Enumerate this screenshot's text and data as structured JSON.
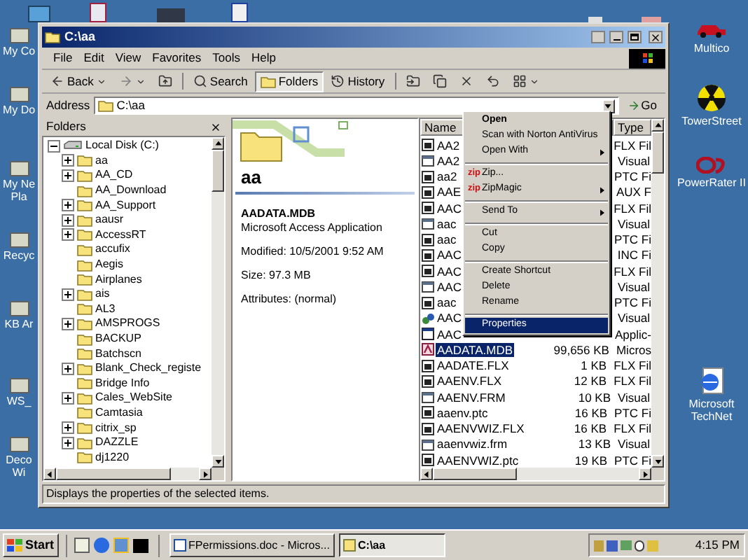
{
  "desktop": {
    "left_icons": [
      {
        "label": "My Co"
      },
      {
        "label": "My Do"
      },
      {
        "label": "My Ne\nPla"
      },
      {
        "label": "Recyc"
      },
      {
        "label": "KB Ar"
      },
      {
        "label": "WS_"
      },
      {
        "label": "Deco\nWi"
      }
    ],
    "right_icons": [
      {
        "label": "Multico",
        "kind": "car"
      },
      {
        "label": "TowerStreet",
        "kind": "radiation"
      },
      {
        "label": "PowerRater II",
        "kind": "logo"
      },
      {
        "label": "Microsoft\nTechNet",
        "kind": "globe"
      }
    ]
  },
  "window": {
    "title": "C:\\aa",
    "menu": [
      "File",
      "Edit",
      "View",
      "Favorites",
      "Tools",
      "Help"
    ],
    "toolbar": [
      {
        "label": "Back",
        "kind": "back"
      },
      {
        "kind": "forward"
      },
      {
        "kind": "up"
      },
      {
        "label": "Search",
        "kind": "search",
        "selected": false
      },
      {
        "label": "Folders",
        "kind": "folders",
        "selected": true
      },
      {
        "label": "History",
        "kind": "history",
        "selected": false
      },
      {
        "kind": "move"
      },
      {
        "kind": "copy"
      },
      {
        "kind": "delete"
      },
      {
        "kind": "undo"
      },
      {
        "kind": "views"
      }
    ],
    "address": {
      "label": "Address",
      "value": "C:\\aa",
      "go": "Go"
    },
    "folders": {
      "title": "Folders",
      "tree": [
        {
          "label": "Local Disk (C:)",
          "expanded": true,
          "children": [
            {
              "label": "aa",
              "expandable": true
            },
            {
              "label": "AA_CD",
              "expandable": true
            },
            {
              "label": "AA_Download",
              "expandable": false
            },
            {
              "label": "AA_Support",
              "expandable": true
            },
            {
              "label": "aausr",
              "expandable": true
            },
            {
              "label": "AccessRT",
              "expandable": true
            },
            {
              "label": "accufix",
              "expandable": false
            },
            {
              "label": "Aegis",
              "expandable": false
            },
            {
              "label": "Airplanes",
              "expandable": false
            },
            {
              "label": "ais",
              "expandable": true
            },
            {
              "label": "AL3",
              "expandable": false
            },
            {
              "label": "AMSPROGS",
              "expandable": true
            },
            {
              "label": "BACKUP",
              "expandable": false
            },
            {
              "label": "Batchscn",
              "expandable": false
            },
            {
              "label": "Blank_Check_registe",
              "expandable": true
            },
            {
              "label": "Bridge Info",
              "expandable": false
            },
            {
              "label": "Cales_WebSite",
              "expandable": true
            },
            {
              "label": "Camtasia",
              "expandable": false
            },
            {
              "label": "citrix_sp",
              "expandable": true
            },
            {
              "label": "DAZZLE",
              "expandable": true
            },
            {
              "label": "dj1220",
              "expandable": false
            }
          ]
        }
      ]
    },
    "preview": {
      "folder": "aa",
      "file": "AADATA.MDB",
      "type": "Microsoft Access Application",
      "modified": "Modified: 10/5/2001 9:52 AM",
      "size": "Size: 97.3 MB",
      "attributes": "Attributes: (normal)"
    },
    "files": {
      "columns": [
        "Name",
        "Type"
      ],
      "rows": [
        {
          "name": "AA2",
          "type": "FLX Fil",
          "kind": "document",
          "selected": false
        },
        {
          "name": "AA2",
          "type": "Visual",
          "kind": "form",
          "selected": false
        },
        {
          "name": "aa2",
          "type": "PTC Fi",
          "kind": "document",
          "selected": false
        },
        {
          "name": "AAE",
          "type": "AUX F",
          "kind": "document",
          "selected": false
        },
        {
          "name": "AAC",
          "type": "FLX Fil",
          "kind": "document",
          "selected": false
        },
        {
          "name": "aac",
          "type": "Visual",
          "kind": "form",
          "selected": false
        },
        {
          "name": "aac",
          "type": "PTC Fi",
          "kind": "document",
          "selected": false
        },
        {
          "name": "AAC",
          "type": "INC Fi",
          "kind": "document",
          "selected": false
        },
        {
          "name": "AAC",
          "type": "FLX Fil",
          "kind": "document",
          "selected": false
        },
        {
          "name": "AAC",
          "type": "Visual",
          "kind": "form",
          "selected": false
        },
        {
          "name": "aac",
          "type": "PTC Fi",
          "kind": "document",
          "selected": false
        },
        {
          "name": "AAC",
          "type": "Visual",
          "kind": "setup",
          "selected": false
        },
        {
          "name": "AAC",
          "type": "Applic-",
          "kind": "application",
          "selected": false
        },
        {
          "name": "AADATA.MDB",
          "size": "99,656 KB",
          "type": "Micros",
          "kind": "access",
          "selected": true
        },
        {
          "name": "AADATE.FLX",
          "size": "1 KB",
          "type": "FLX Fil",
          "kind": "document",
          "selected": false
        },
        {
          "name": "AAENV.FLX",
          "size": "12 KB",
          "type": "FLX Fil",
          "kind": "document",
          "selected": false
        },
        {
          "name": "AAENV.FRM",
          "size": "10 KB",
          "type": "Visual",
          "kind": "form",
          "selected": false
        },
        {
          "name": "aaenv.ptc",
          "size": "16 KB",
          "type": "PTC Fi",
          "kind": "document",
          "selected": false
        },
        {
          "name": "AAENVWIZ.FLX",
          "size": "16 KB",
          "type": "FLX Fil",
          "kind": "document",
          "selected": false
        },
        {
          "name": "aaenvwiz.frm",
          "size": "13 KB",
          "type": "Visual",
          "kind": "form",
          "selected": false
        },
        {
          "name": "AAENVWIZ.ptc",
          "size": "19 KB",
          "type": "PTC Fi",
          "kind": "document",
          "selected": false
        }
      ]
    },
    "context_menu": [
      {
        "kind": "item",
        "label": "Open",
        "default": true,
        "submenu": false,
        "selected": false
      },
      {
        "kind": "item",
        "label": "Scan with Norton AntiVirus",
        "default": false,
        "submenu": false,
        "selected": false
      },
      {
        "kind": "item",
        "label": "Open With",
        "default": false,
        "submenu": true,
        "selected": false
      },
      {
        "kind": "separator"
      },
      {
        "kind": "item",
        "label": "Zip...",
        "badge": "zip",
        "default": false,
        "submenu": false,
        "selected": false
      },
      {
        "kind": "item",
        "label": "ZipMagic",
        "badge": "zip",
        "default": false,
        "submenu": true,
        "selected": false
      },
      {
        "kind": "separator"
      },
      {
        "kind": "item",
        "label": "Send To",
        "default": false,
        "submenu": true,
        "selected": false
      },
      {
        "kind": "separator"
      },
      {
        "kind": "item",
        "label": "Cut",
        "default": false,
        "submenu": false,
        "selected": false
      },
      {
        "kind": "item",
        "label": "Copy",
        "default": false,
        "submenu": false,
        "selected": false
      },
      {
        "kind": "separator"
      },
      {
        "kind": "item",
        "label": "Create Shortcut",
        "default": false,
        "submenu": false,
        "selected": false
      },
      {
        "kind": "item",
        "label": "Delete",
        "default": false,
        "submenu": false,
        "selected": false
      },
      {
        "kind": "item",
        "label": "Rename",
        "default": false,
        "submenu": false,
        "selected": false
      },
      {
        "kind": "separator"
      },
      {
        "kind": "item",
        "label": "Properties",
        "default": false,
        "submenu": false,
        "selected": true
      }
    ],
    "status_bar": "Displays the properties of the selected items."
  },
  "taskbar": {
    "start": "Start",
    "tasks": [
      {
        "label": "FPermissions.doc - Micros...",
        "selected": false
      },
      {
        "label": "C:\\aa",
        "selected": true
      }
    ],
    "clock": "4:15 PM"
  }
}
